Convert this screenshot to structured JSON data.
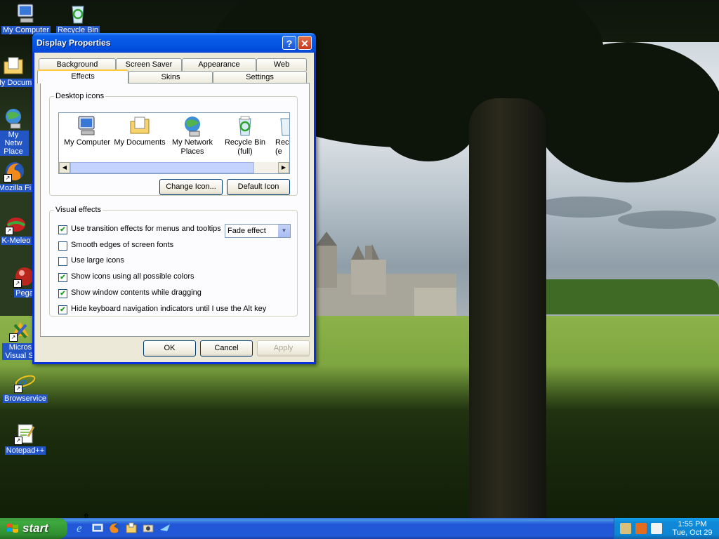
{
  "desktop": {
    "icons": [
      {
        "label": "My Computer",
        "icon": "computer-icon"
      },
      {
        "label": "Recycle Bin",
        "icon": "recycle-bin-icon"
      },
      {
        "label": "My Docum",
        "icon": "documents-folder-icon"
      },
      {
        "label": "My Netw Place",
        "icon": "network-places-icon"
      },
      {
        "label": "Mozilla Fi",
        "icon": "firefox-icon"
      },
      {
        "label": "K-Meleo",
        "icon": "k-meleon-icon"
      },
      {
        "label": "Pega",
        "icon": "pegasus-icon"
      },
      {
        "label": "Micros Visual St",
        "icon": "visual-studio-icon"
      },
      {
        "label": "Browservice",
        "icon": "internet-explorer-icon"
      },
      {
        "label": "Notepad++",
        "icon": "notepad-plus-plus-icon"
      }
    ]
  },
  "dialog": {
    "title": "Display Properties",
    "tabs_row1": [
      "Background",
      "Screen Saver",
      "Appearance",
      "Web"
    ],
    "tabs_row2": [
      "Effects",
      "Skins",
      "Settings"
    ],
    "active_tab": "Effects",
    "desktop_icons": {
      "legend": "Desktop icons",
      "items": [
        {
          "label": "My Computer",
          "icon": "computer-icon"
        },
        {
          "label": "My Documents",
          "icon": "documents-folder-icon"
        },
        {
          "label": "My Network Places",
          "icon": "network-places-icon"
        },
        {
          "label": "Recycle Bin (full)",
          "icon": "recycle-bin-full-icon"
        },
        {
          "label": "Rec (e",
          "icon": "recycle-bin-empty-icon"
        }
      ],
      "change_icon": "Change Icon...",
      "default_icon": "Default Icon"
    },
    "visual_effects": {
      "legend": "Visual effects",
      "options": [
        {
          "label": "Use transition effects for menus and tooltips",
          "checked": true
        },
        {
          "label": "Smooth edges of screen fonts",
          "checked": false
        },
        {
          "label": "Use large icons",
          "checked": false
        },
        {
          "label": "Show icons using all possible colors",
          "checked": true
        },
        {
          "label": "Show window contents while dragging",
          "checked": true
        },
        {
          "label": "Hide keyboard navigation indicators until I use the Alt key",
          "checked": true
        }
      ],
      "transition_effect": "Fade effect"
    },
    "buttons": {
      "ok": "OK",
      "cancel": "Cancel",
      "apply": "Apply"
    }
  },
  "taskbar": {
    "start_label": "start",
    "quick_launch": [
      "internet-explorer-icon",
      "show-desktop-icon",
      "firefox-icon",
      "windows-explorer-icon",
      "camera-icon",
      "k-meleon-icon"
    ],
    "tray_icons": [
      "network-icon",
      "antivirus-icon",
      "printer-icon"
    ],
    "clock_time": "1:55 PM",
    "clock_date": "Tue, Oct 29"
  },
  "colors": {
    "title_bar": "#0554e2",
    "dialog_face": "#ece9d8",
    "taskbar": "#2259d7",
    "start_button": "#3ea93e",
    "tray": "#0d85d4"
  }
}
